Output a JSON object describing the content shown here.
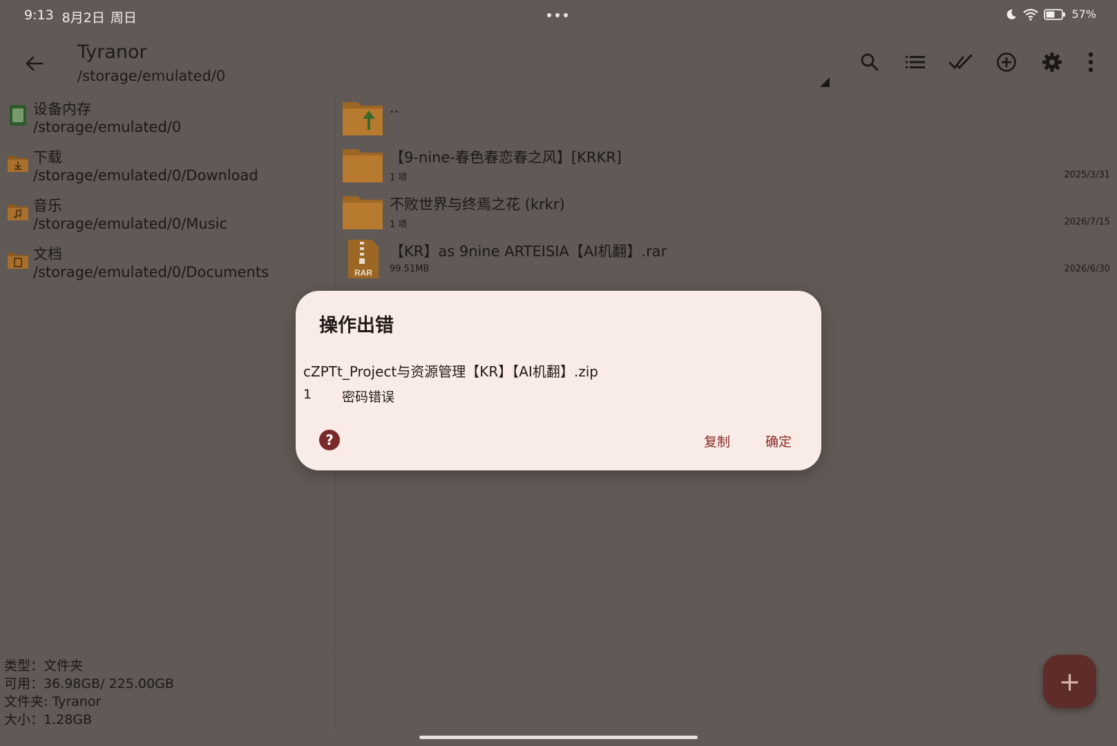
{
  "status_bar": {
    "time": "9:13",
    "date": "8月2日",
    "weekday": "周日",
    "battery": "57%",
    "icons": [
      "moon-icon",
      "wifi-icon",
      "battery-icon"
    ]
  },
  "app_bar": {
    "title": "Tyranor",
    "subtitle": "/storage/emulated/0",
    "actions": [
      "search-icon",
      "list-view-icon",
      "select-all-icon",
      "add-circle-icon",
      "gear-icon",
      "more-vert-icon"
    ]
  },
  "sidebar": {
    "items": [
      {
        "name": "设备内存",
        "path": "/storage/emulated/0",
        "icon": "device-storage-icon"
      },
      {
        "name": "下载",
        "path": "/storage/emulated/0/Download",
        "icon": "download-folder-icon"
      },
      {
        "name": "音乐",
        "path": "/storage/emulated/0/Music",
        "icon": "music-folder-icon"
      },
      {
        "name": "文档",
        "path": "/storage/emulated/0/Documents",
        "icon": "documents-folder-icon"
      }
    ],
    "footer": {
      "type": "类型：文件夹",
      "available": "可用：36.98GB/ 225.00GB",
      "folder": "文件夹: Tyranor",
      "size": "大小：1.28GB"
    }
  },
  "files": [
    {
      "name": "..",
      "meta": "",
      "date": "",
      "icon": "parent-folder-icon"
    },
    {
      "name": "【9-nine-春色春恋春之风】[KRKR]",
      "meta": "1 项",
      "date": "2025/3/31",
      "icon": "folder-icon"
    },
    {
      "name": "不败世界与终焉之花 (krkr)",
      "meta": "1 项",
      "date": "2026/7/15",
      "icon": "folder-icon"
    },
    {
      "name": "【KR】as 9nine ARTEISIA【AI机翻】.rar",
      "meta": "99.51MB",
      "date": "2026/6/30",
      "icon": "rar-file-icon"
    }
  ],
  "dialog": {
    "title": "操作出错",
    "file": "cZPTt_Project与资源管理【KR】【AI机翻】.zip",
    "error_num": "1",
    "error_msg": "密码错误",
    "copy_label": "复制",
    "ok_label": "确定"
  },
  "fab": {
    "label": "+"
  },
  "colors": {
    "background": "#615955",
    "dialog_bg": "#f9ece7",
    "accent": "#8a2b27",
    "fab": "#5e2c29",
    "folder": "#c8882c"
  }
}
